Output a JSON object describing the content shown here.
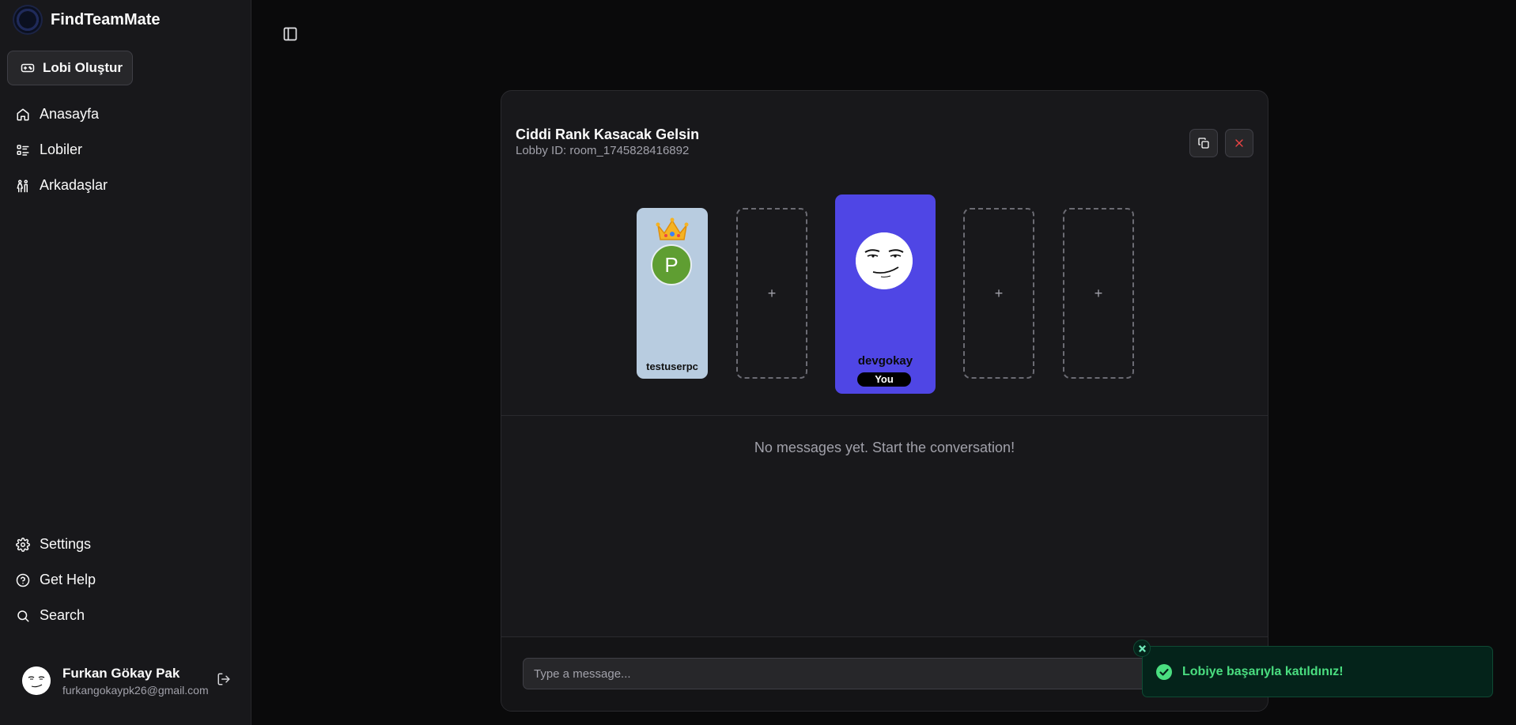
{
  "app": {
    "name": "FindTeamMate"
  },
  "sidebar": {
    "create_label": "Lobi Oluştur",
    "nav_main": [
      {
        "label": "Anasayfa",
        "icon": "home-icon"
      },
      {
        "label": "Lobiler",
        "icon": "list-icon"
      },
      {
        "label": "Arkadaşlar",
        "icon": "users-icon"
      }
    ],
    "nav_secondary": [
      {
        "label": "Settings",
        "icon": "gear-icon"
      },
      {
        "label": "Get Help",
        "icon": "help-circle-icon"
      },
      {
        "label": "Search",
        "icon": "search-icon"
      }
    ],
    "user": {
      "name": "Furkan Gökay Pak",
      "email": "furkangokaypk26@gmail.com"
    }
  },
  "lobby": {
    "title": "Ciddi Rank Kasacak Gelsin",
    "lobby_id_text": "Lobby ID: room_1745828416892",
    "slots": [
      {
        "type": "player",
        "username": "testuserpc",
        "avatar_initial": "P",
        "is_owner": true
      },
      {
        "type": "empty",
        "label": "+"
      },
      {
        "type": "player",
        "username": "devgokay",
        "badge": "You",
        "is_self": true
      },
      {
        "type": "empty",
        "label": "+"
      },
      {
        "type": "empty",
        "label": "+"
      }
    ],
    "empty_chat_text": "No messages yet. Start the conversation!",
    "message_placeholder": "Type a message..."
  },
  "toast": {
    "text": "Lobiye başarıyla katıldınız!"
  },
  "colors": {
    "owner_slot": "#b8cce0",
    "self_slot": "#4f46e5",
    "owner_avatar": "#5f9e32",
    "toast_text": "#4ade80",
    "close_x": "#ef4444"
  }
}
